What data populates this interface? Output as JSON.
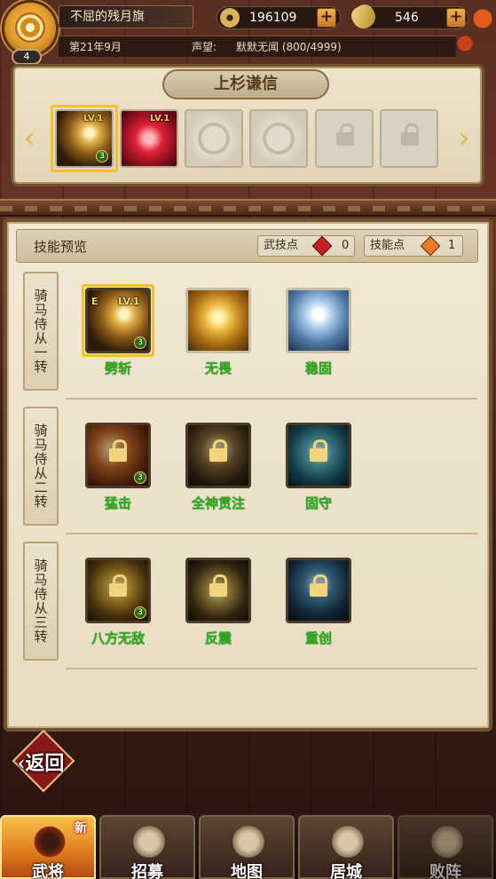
{
  "header": {
    "player_level": "4",
    "title": "不屈的残月旗",
    "coins": "196109",
    "jade": "546",
    "date": "第21年9月",
    "fame_label": "声望:",
    "fame_value": "默默无闻 (800/4999)"
  },
  "hero": {
    "name": "上杉谦信",
    "equipped_skills": [
      {
        "icon": "slash-skill-icon",
        "level": "LV.1",
        "count": "3",
        "selected": true
      },
      {
        "icon": "red-shield-skill-icon",
        "level": "LV.1",
        "selected": false
      }
    ],
    "empty_slots": 2,
    "locked_slots": 2
  },
  "preview": {
    "title": "技能预览",
    "martial_points_label": "武技点",
    "martial_points_value": "0",
    "skill_points_label": "技能点",
    "skill_points_value": "1"
  },
  "tiers": [
    {
      "label": "骑马侍从一转",
      "skills": [
        {
          "name": "劈斩",
          "icon": "slash-icon",
          "level": "LV.1",
          "equipped_mark": "E",
          "count": "3",
          "locked": false
        },
        {
          "name": "无畏",
          "icon": "samurai-icon",
          "locked": false
        },
        {
          "name": "稳固",
          "icon": "shield-icon",
          "locked": false
        }
      ]
    },
    {
      "label": "骑马侍从二转",
      "skills": [
        {
          "name": "猛击",
          "icon": "strike-icon",
          "count": "3",
          "locked": true
        },
        {
          "name": "全神贯注",
          "icon": "focus-icon",
          "locked": true
        },
        {
          "name": "固守",
          "icon": "guard-icon",
          "locked": true
        }
      ]
    },
    {
      "label": "骑马侍从三转",
      "skills": [
        {
          "name": "八方无敌",
          "icon": "eight-directions-icon",
          "count": "3",
          "locked": true
        },
        {
          "name": "反震",
          "icon": "counter-icon",
          "locked": true
        },
        {
          "name": "重创",
          "icon": "heavy-wound-icon",
          "locked": true
        }
      ]
    }
  ],
  "back_label": "返回",
  "nav": [
    {
      "label": "武将",
      "badge": "新",
      "active": true
    },
    {
      "label": "招募",
      "active": false
    },
    {
      "label": "地图",
      "active": false
    },
    {
      "label": "居城",
      "active": false
    },
    {
      "label": "败阵",
      "active": false
    }
  ],
  "colors": {
    "skill_name_green": "#2fae1f",
    "accent_gold": "#f0c12a",
    "panel_parchment": "#f1e8d4"
  }
}
